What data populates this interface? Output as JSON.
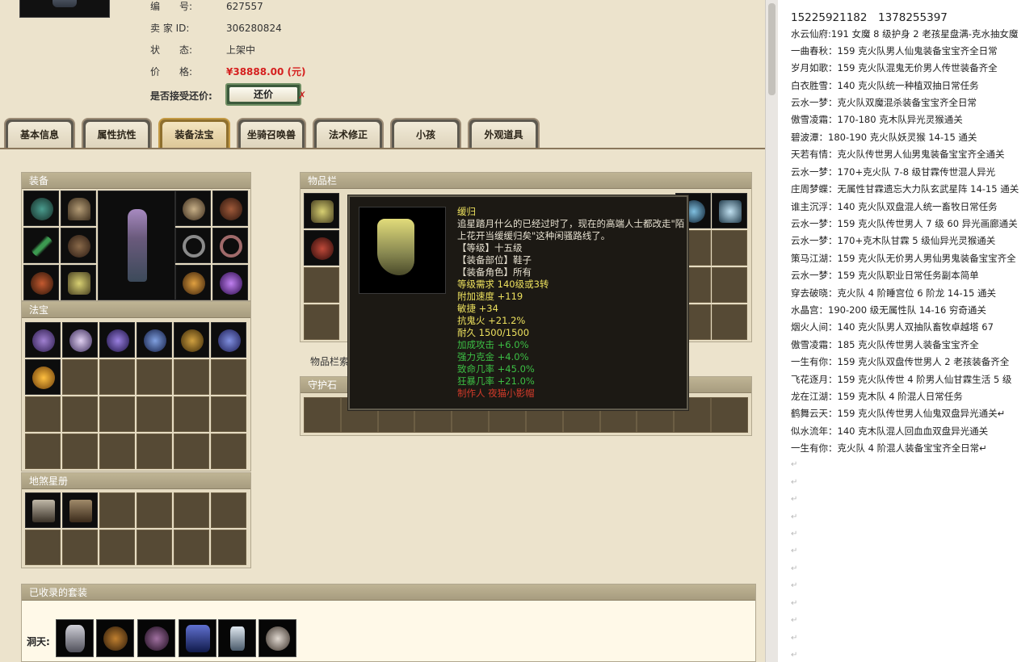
{
  "item_info": {
    "number_label": "编　　号:",
    "number_value": "627557",
    "seller_label": "卖 家 ID:",
    "seller_value": "306280824",
    "status_label": "状　　态:",
    "status_value": "上架中",
    "price_label": "价　　格:",
    "price_value": "¥38888.00 (元)",
    "offer_label": "是否接受还价:",
    "offer_button": "还价",
    "offer_mark": "✗"
  },
  "tabs": [
    "基本信息",
    "属性抗性",
    "装备法宝",
    "坐骑召唤兽",
    "法术修正",
    "小孩",
    "外观道具"
  ],
  "active_tab": "装备法宝",
  "panels": {
    "equipment": "装备",
    "magic": "法宝",
    "star_book": "地煞星册",
    "inventory": "物品栏",
    "inventory_caption": "物品栏索",
    "guard_stone": "守护石",
    "suits": "已收录的套装",
    "cave_label": "洞天:"
  },
  "tooltip": {
    "name": "缓归",
    "desc": "追星踏月什么的已经过时了，现在的高端人士都改走\"陌上花开当缓缓归矣\"这种闲骚路线了。",
    "level": "【等级】十五级",
    "slot": "【装备部位】鞋子",
    "role": "【装备角色】所有",
    "require": "等级需求 140级或3转",
    "speed": "附加速度 +119",
    "agility": "敏捷 +34",
    "resist_fire": "抗鬼火 +21.2%",
    "durability": "耐久 1500/1500",
    "attack": "加成攻击 +6.0%",
    "strength": "强力克金 +4.0%",
    "crit": "致命几率 +45.0%",
    "frenzy": "狂暴几率 +21.0%",
    "maker": "制作人 夜猫小影帽"
  },
  "right_panel": {
    "phones": "15225921182　1378255397",
    "lines": [
      "水云仙府:191 女魔 8 级护身 2 老孩星盘满-克水抽女魔",
      "一曲春秋：159 克火队男人仙鬼装备宝宝齐全日常",
      "岁月如歌：159 克火队混鬼无价男人传世装备齐全",
      "白衣胜雪：140 克火队统一种植双抽日常任务",
      "云水一梦：克火队双魔混杀装备宝宝齐全日常",
      "傲雪凌霜：170-180 克木队异光灵猴通关",
      "碧波潭：180-190 克火队妖灵猴 14-15 通关",
      "天若有情：克火队传世男人仙男鬼装备宝宝齐全通关",
      "云水一梦：170+克火队 7-8 级甘霖传世混人异光",
      "庄周梦蝶：无属性甘霖遗忘大力队玄武星阵 14-15 通关",
      "谁主沉浮：140 克火队双盘混人统一畜牧日常任务",
      "云水一梦：159 克火队传世男人 7 级 60 异光画廊通关",
      "云水一梦：170+克木队甘霖 5 级仙异光灵猴通关",
      "策马江湖：159 克火队无价男人男仙男鬼装备宝宝齐全",
      "云水一梦：159 克火队职业日常任务副本简单",
      "穿去破晓：克火队 4 阶睡宫位 6 阶龙 14-15 通关",
      "水晶宫：190-200 级无属性队 14-16 穷奇通关",
      "烟火人间：140 克火队男人双抽队畜牧卓越塔 67",
      "傲雪凌霜：185 克火队传世男人装备宝宝齐全",
      "一生有你：159 克火队双盘传世男人 2 老孩装备齐全",
      "飞花逐月：159 克火队传世 4 阶男人仙甘霖生活 5 级",
      "龙在江湖：159 克木队 4 阶混人日常任务",
      "鹤舞云天：159 克火队传世男人仙鬼双盘异光通关↵",
      "似水流年：140 克木队混人回血血双盘异光通关",
      "一生有你：克火队 4 阶混人装备宝宝齐全日常↵"
    ],
    "return_mark": "↵"
  }
}
